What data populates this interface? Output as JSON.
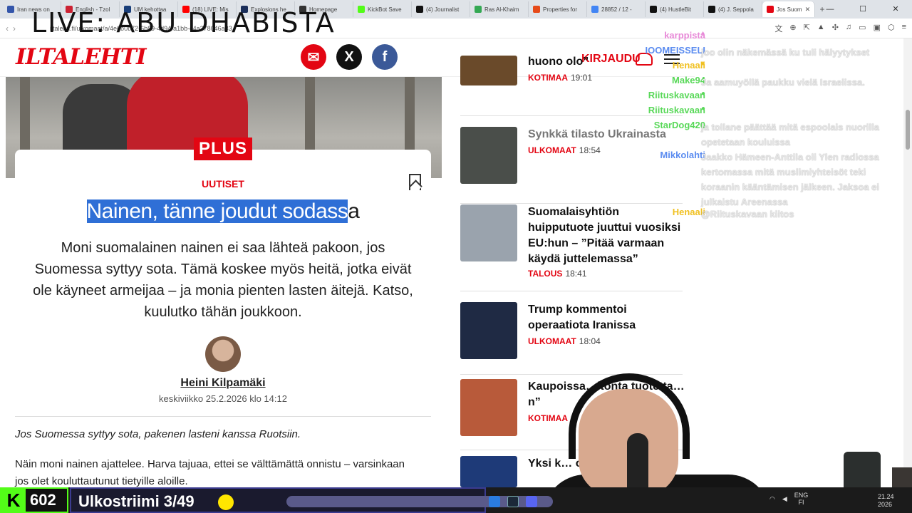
{
  "overlay": {
    "live_title": "LIVE: ABU DHABISTA"
  },
  "browser": {
    "tabs": [
      {
        "label": "Iran news on",
        "color": "#3355aa"
      },
      {
        "label": "English - Tzol",
        "color": "#cc2233"
      },
      {
        "label": "UM kehottaa",
        "color": "#1a3f7a"
      },
      {
        "label": "(18) LIVE: Mis",
        "color": "#ff0000"
      },
      {
        "label": "Explosions he",
        "color": "#1a2e5a"
      },
      {
        "label": "Homepage",
        "color": "#333333"
      },
      {
        "label": "KickBot Save",
        "color": "#53fc18"
      },
      {
        "label": "(4) Journalist",
        "color": "#111111"
      },
      {
        "label": "Ras Al-Khaim",
        "color": "#34a853"
      },
      {
        "label": "Properties for",
        "color": "#e64a19"
      },
      {
        "label": "28852 / 12 - ",
        "color": "#4285f4"
      },
      {
        "label": "(4) HustleBit",
        "color": "#111111"
      },
      {
        "label": "(4) J. Seppola",
        "color": "#111111"
      },
      {
        "label": "Jos Suom",
        "color": "#e30613"
      }
    ],
    "url": "iltalehti.fi/ulkomaat/a/4e6b0b72-6b89-4d94-a1bb-c4a378046a83"
  },
  "site": {
    "logo": "ILTALEHTI",
    "login": "KIRJAUDU",
    "brand_color": "#e30613"
  },
  "article": {
    "badge": "PLUS",
    "category": "UUTISET",
    "headline_selected": "Nainen, tänne joudut sodass",
    "headline_rest": "a",
    "lead": "Moni suomalainen nainen ei saa lähteä pakoon, jos Suomessa syttyy sota. Tämä koskee myös heitä, jotka eivät ole käyneet armeijaa – ja monia pienten lasten äitejä. Katso, kuulutko tähän joukkoon.",
    "author": "Heini Kilpamäki",
    "date": "keskiviikko 25.2.2026 klo 14:12",
    "intro": "Jos Suomessa syttyy sota, pakenen lasteni kanssa Ruotsiin.",
    "body": "Näin moni nainen ajattelee. Harva tajuaa, ettei se välttämättä onnistu – varsinkaan jos olet kouluttautunut tietyille aloille."
  },
  "news": [
    {
      "title": "huono olo”",
      "section": "KOTIMAA",
      "time": "19:01",
      "read": false,
      "thumb": "#6a4a2a"
    },
    {
      "title": "Synkkä tilasto Ukrainasta",
      "section": "ULKOMAAT",
      "time": "18:54",
      "read": true,
      "thumb": "#4a4e4a"
    },
    {
      "title": "Suomalaisyhtiön huipputuote juuttui vuosiksi EU:hun – ”Pitää varmaan käydä juttelemassa”",
      "section": "TALOUS",
      "time": "18:41",
      "read": false,
      "thumb": "#9aa3ad"
    },
    {
      "title": "Trump kommentoi operaatiota Iranissa",
      "section": "ULKOMAAT",
      "time": "18:04",
      "read": false,
      "thumb": "#1f2a44"
    },
    {
      "title": "Kaupoissa…itonta tuotetta…n”",
      "section": "KOTIMAA",
      "time": "",
      "read": false,
      "thumb": "#b85a3a"
    },
    {
      "title": "Yksi k… onn…",
      "section": "",
      "time": "",
      "read": false,
      "thumb": "#1e3a78"
    }
  ],
  "chat": [
    {
      "nick": "karppista",
      "color": "#e88ad8",
      "badge": "♦",
      "msg": ""
    },
    {
      "nick": "IOOMEISSELI",
      "color": "#5b8cf0",
      "badge": "",
      "msg": "joo olin näkemässä ku tuli hälyytykset"
    },
    {
      "nick": "Henaali",
      "color": "#f0c020",
      "badge": "♦",
      "msg": ""
    },
    {
      "nick": "Make94",
      "color": "#58d858",
      "badge": "",
      "msg": "Ja aamuyöllä paukku vielä Israelissa."
    },
    {
      "nick": "Riituskavaan",
      "color": "#58d858",
      "badge": "●",
      "msg": ""
    },
    {
      "nick": "Riituskavaan",
      "color": "#58d858",
      "badge": "●",
      "msg": ""
    },
    {
      "nick": "StarDog420",
      "color": "#58d858",
      "badge": "",
      "msg": "ja tollane päättää mitä espoolais nuorilla opetetaan kouluissa"
    },
    {
      "nick": "Mikkolahti",
      "color": "#5b8cf0",
      "badge": "",
      "msg": "Jaakko Hämeen-Anttila oli Ylen radiossa kertomassa mitä muslimiyhteisöt teki koraanin kääntämisen jälkeen. Jaksoa ei julkaistu Areenassa"
    },
    {
      "nick": "Henaali",
      "color": "#f0c020",
      "badge": "",
      "msg": "@Riituskavaan kiitos"
    }
  ],
  "stream": {
    "viewers": "602",
    "label": "Ulkostriimi 3/49",
    "progress": 0.06
  },
  "tray": {
    "lang_top": "ENG",
    "lang_bottom": "FI",
    "time": "21.24",
    "date": "2026"
  }
}
